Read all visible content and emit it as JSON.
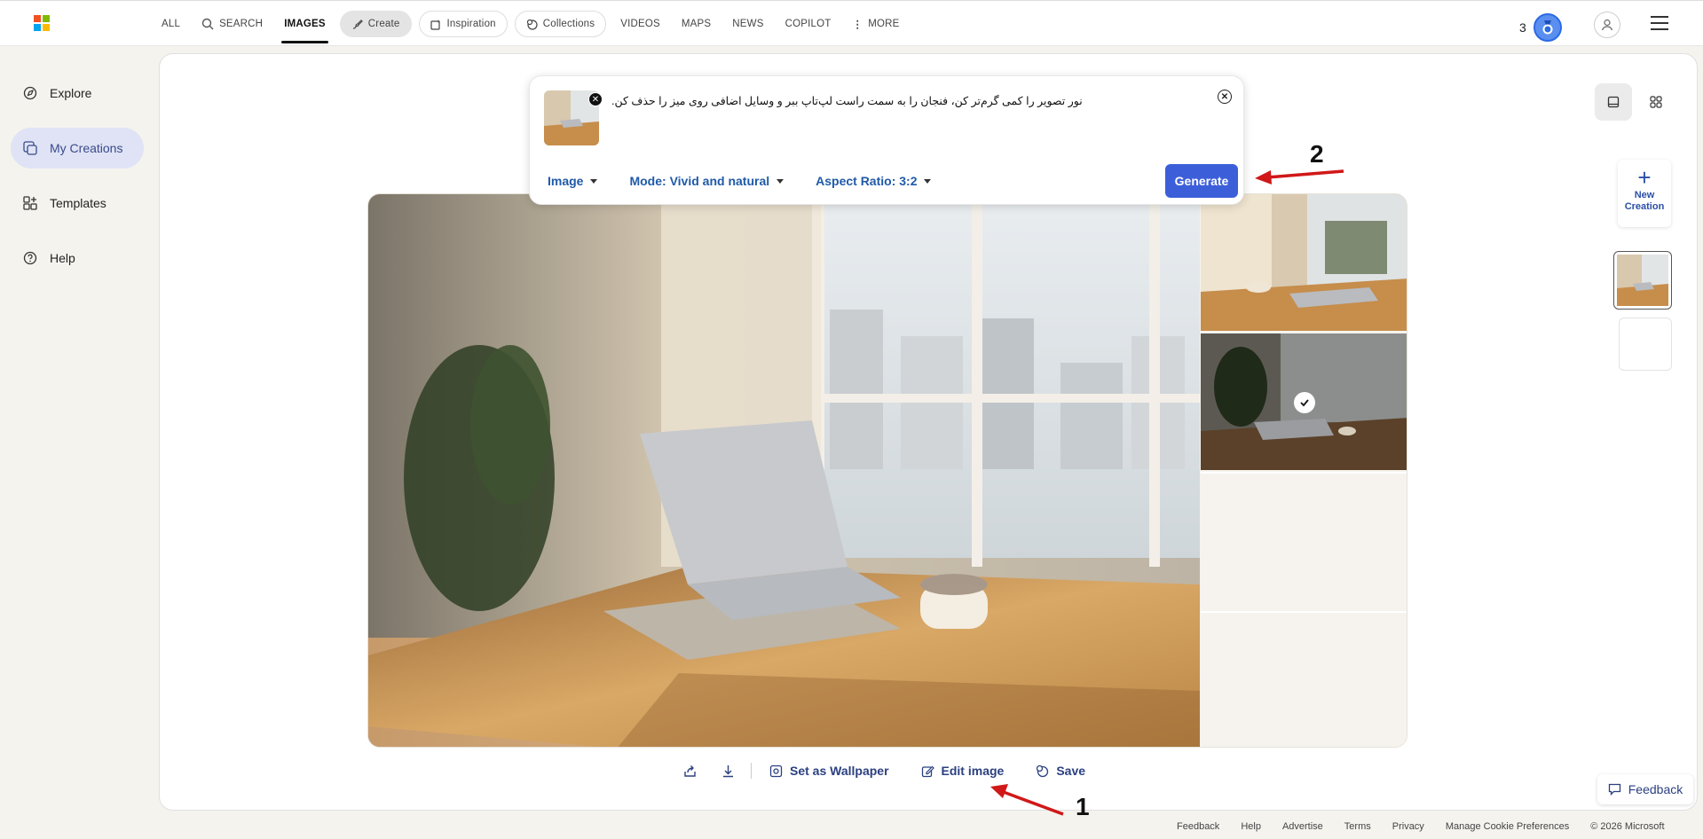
{
  "header": {
    "nav": [
      {
        "label": "ALL"
      },
      {
        "label": "SEARCH"
      },
      {
        "label": "IMAGES"
      },
      {
        "label": "Create"
      },
      {
        "label": "Inspiration"
      },
      {
        "label": "Collections"
      },
      {
        "label": "VIDEOS"
      },
      {
        "label": "MAPS"
      },
      {
        "label": "NEWS"
      },
      {
        "label": "COPILOT"
      },
      {
        "label": "MORE"
      }
    ],
    "reward_count": "3",
    "colors": {
      "ms_red": "#f25022",
      "ms_green": "#7fba00",
      "ms_blue": "#00a4ef",
      "ms_yellow": "#ffb900"
    }
  },
  "sidebar": {
    "items": [
      {
        "label": "Explore",
        "icon": "explore-icon"
      },
      {
        "label": "My Creations",
        "icon": "creations-icon"
      },
      {
        "label": "Templates",
        "icon": "templates-icon"
      },
      {
        "label": "Help",
        "icon": "help-icon"
      }
    ]
  },
  "prompt": {
    "text": "نور تصویر را کمی گرم‌تر کن، فنجان را به سمت راست لپ‌تاپ ببر و وسایل اضافی روی میز را حذف کن.",
    "options": [
      {
        "label": "Image"
      },
      {
        "label": "Mode: Vivid and natural"
      },
      {
        "label": "Aspect Ratio: 3:2"
      }
    ],
    "generate_label": "Generate"
  },
  "right_rail": {
    "new_creation_line1": "New",
    "new_creation_line2": "Creation"
  },
  "actions": {
    "wallpaper": "Set as Wallpaper",
    "edit": "Edit image",
    "save": "Save"
  },
  "annotations": {
    "one": "1",
    "two": "2"
  },
  "feedback_label": "Feedback",
  "footer": [
    {
      "label": "Feedback"
    },
    {
      "label": "Help"
    },
    {
      "label": "Advertise"
    },
    {
      "label": "Terms"
    },
    {
      "label": "Privacy"
    },
    {
      "label": "Manage Cookie Preferences"
    },
    {
      "label": "© 2026 Microsoft"
    }
  ]
}
